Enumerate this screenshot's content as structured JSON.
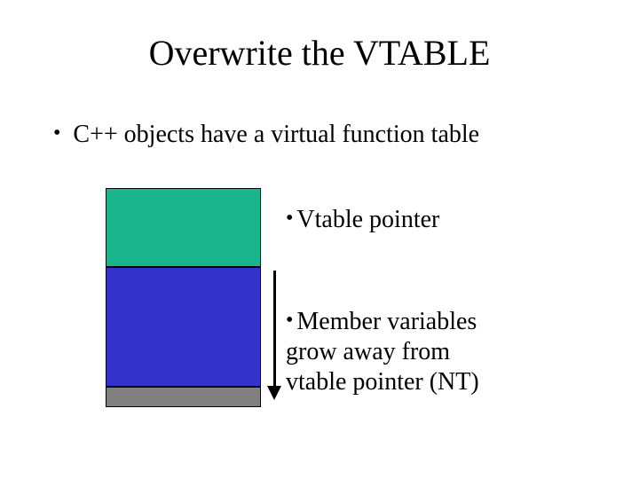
{
  "title": "Overwrite the VTABLE",
  "main_bullet": "C++ objects have a virtual function table",
  "label_vtable": "Vtable pointer",
  "label_member_l1": "Member variables",
  "label_member_l2": "grow away from",
  "label_member_l3": "vtable pointer (NT)",
  "colors": {
    "top": "#1ab58a",
    "mid": "#3333cc",
    "bot": "#808080"
  }
}
